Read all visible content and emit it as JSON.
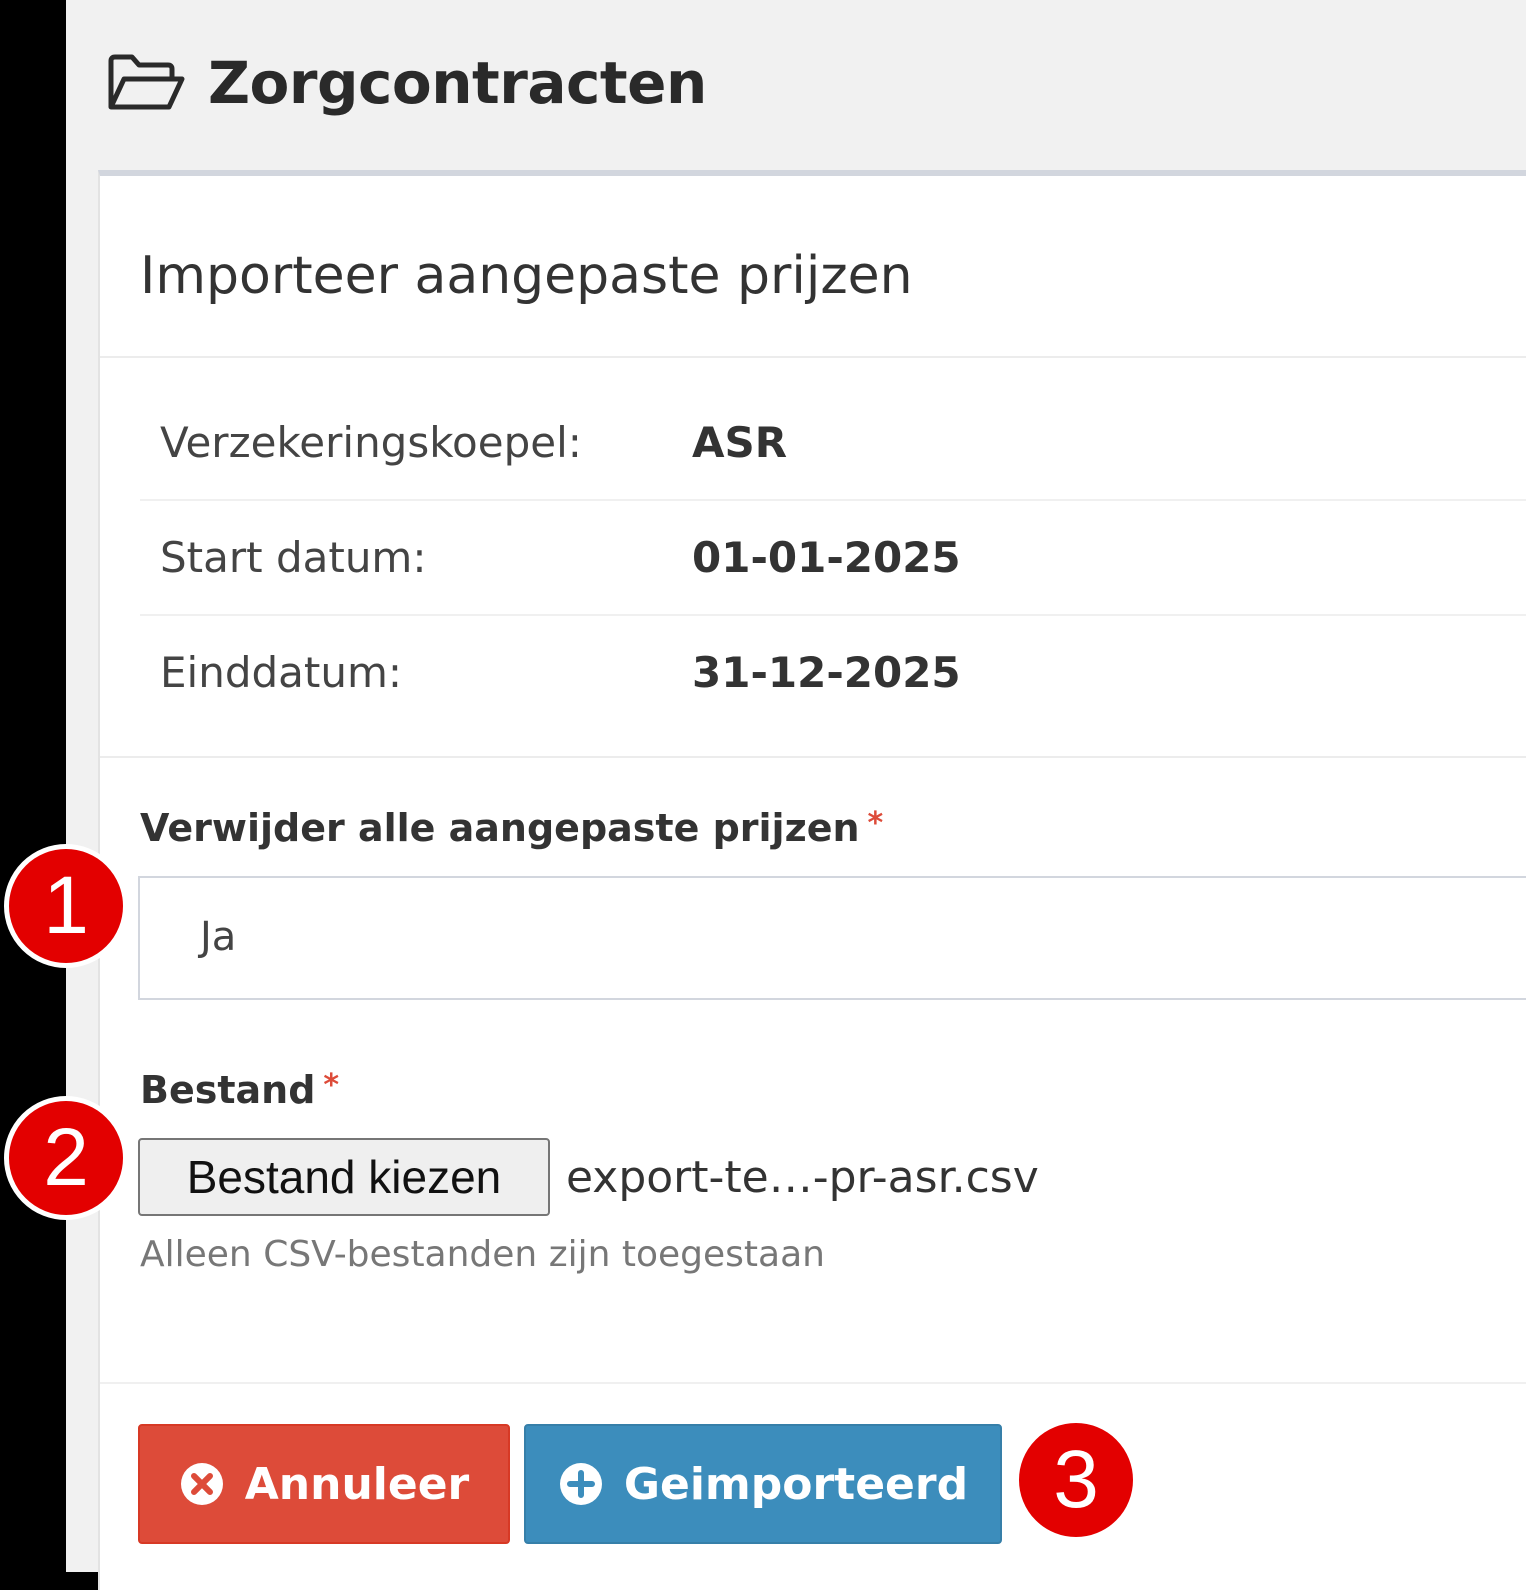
{
  "page": {
    "title": "Zorgcontracten"
  },
  "card": {
    "title": "Importeer aangepaste prijzen",
    "info": [
      {
        "label": "Verzekeringskoepel:",
        "value": "ASR"
      },
      {
        "label": "Start datum:",
        "value": "01-01-2025"
      },
      {
        "label": "Einddatum:",
        "value": "31-12-2025"
      }
    ]
  },
  "form": {
    "delete_prices": {
      "label": "Verwijder alle aangepaste prijzen",
      "required_mark": "*",
      "value": "Ja"
    },
    "file": {
      "label": "Bestand",
      "required_mark": "*",
      "button_label": "Bestand kiezen",
      "selected_file": "export-te…-pr-asr.csv",
      "help": "Alleen CSV-bestanden zijn toegestaan"
    }
  },
  "buttons": {
    "cancel": "Annuleer",
    "import": "Geimporteerd"
  },
  "callouts": [
    "1",
    "2",
    "3"
  ],
  "colors": {
    "danger": "#dd4b39",
    "primary": "#3c8dbc",
    "callout": "#e30000"
  },
  "icons": {
    "title": "folder-open-icon",
    "cancel": "times-circle-icon",
    "import": "plus-circle-icon"
  }
}
